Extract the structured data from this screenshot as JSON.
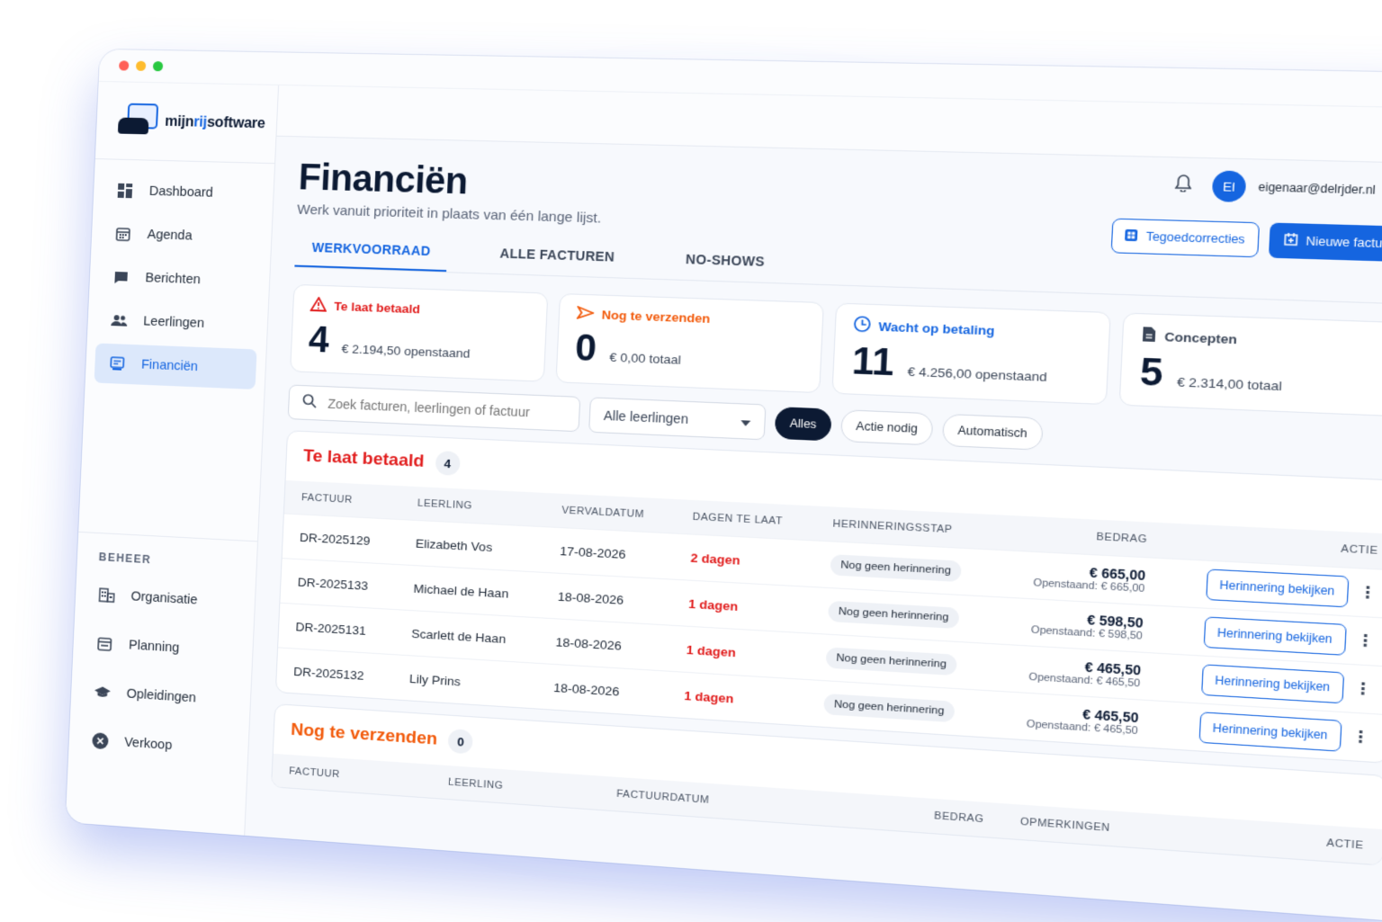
{
  "brand": {
    "prefix": "mijn",
    "accent": "rij",
    "suffix": "software"
  },
  "sidebar": {
    "items": [
      {
        "label": "Dashboard",
        "icon": "grid-icon"
      },
      {
        "label": "Agenda",
        "icon": "calendar-icon"
      },
      {
        "label": "Berichten",
        "icon": "chat-icon"
      },
      {
        "label": "Leerlingen",
        "icon": "users-icon"
      },
      {
        "label": "Financiën",
        "icon": "invoice-icon",
        "active": true
      }
    ],
    "section_label": "BEHEER",
    "section_items": [
      {
        "label": "Organisatie",
        "icon": "building-icon"
      },
      {
        "label": "Planning",
        "icon": "calendar-check-icon"
      },
      {
        "label": "Opleidingen",
        "icon": "graduation-cap-icon"
      },
      {
        "label": "Verkoop",
        "icon": "close-circle-icon"
      }
    ]
  },
  "user": {
    "initials": "EI",
    "email": "eigenaar@delrjder.nl"
  },
  "page": {
    "title": "Financiën",
    "subtitle": "Werk vanuit prioriteit in plaats van één lange lijst.",
    "btn_credit": "Tegoedcorrecties",
    "btn_new": "Nieuwe factuur"
  },
  "tabs": [
    {
      "label": "WERKVOORRAAD",
      "active": true
    },
    {
      "label": "ALLE FACTUREN"
    },
    {
      "label": "NO-SHOWS"
    }
  ],
  "stats": [
    {
      "title": "Te laat betaald",
      "number": "4",
      "sub": "€ 2.194,50 openstaand",
      "color": "#e11d1d",
      "icon": "warning-icon"
    },
    {
      "title": "Nog te verzenden",
      "number": "0",
      "sub": "€ 0,00 totaal",
      "color": "#f25a0b",
      "icon": "send-icon"
    },
    {
      "title": "Wacht op betaling",
      "number": "11",
      "sub": "€ 4.256,00 openstaand",
      "color": "#1565e0",
      "icon": "clock-icon"
    },
    {
      "title": "Concepten",
      "number": "5",
      "sub": "€ 2.314,00 totaal",
      "color": "#3b4658",
      "icon": "document-icon"
    }
  ],
  "filters": {
    "search_placeholder": "Zoek facturen, leerlingen of factuur",
    "select_value": "Alle leerlingen",
    "chips": [
      {
        "label": "Alles",
        "active": true
      },
      {
        "label": "Actie nodig"
      },
      {
        "label": "Automatisch"
      }
    ]
  },
  "late_panel": {
    "title": "Te laat betaald",
    "count": "4",
    "columns": [
      "FACTUUR",
      "LEERLING",
      "VERVALDATUM",
      "DAGEN TE LAAT",
      "HERINNERINGSSTAP",
      "BEDRAG",
      "ACTIE"
    ],
    "rows": [
      {
        "invoice": "DR-2025129",
        "student": "Elizabeth Vos",
        "due": "17-08-2026",
        "days": "2 dagen",
        "step": "Nog geen herinnering",
        "amount": "€ 665,00",
        "open": "Openstaand: € 665,00",
        "action": "Herinnering bekijken"
      },
      {
        "invoice": "DR-2025133",
        "student": "Michael de Haan",
        "due": "18-08-2026",
        "days": "1 dagen",
        "step": "Nog geen herinnering",
        "amount": "€ 598,50",
        "open": "Openstaand: € 598,50",
        "action": "Herinnering bekijken"
      },
      {
        "invoice": "DR-2025131",
        "student": "Scarlett de Haan",
        "due": "18-08-2026",
        "days": "1 dagen",
        "step": "Nog geen herinnering",
        "amount": "€ 465,50",
        "open": "Openstaand: € 465,50",
        "action": "Herinnering bekijken"
      },
      {
        "invoice": "DR-2025132",
        "student": "Lily Prins",
        "due": "18-08-2026",
        "days": "1 dagen",
        "step": "Nog geen herinnering",
        "amount": "€ 465,50",
        "open": "Openstaand: € 465,50",
        "action": "Herinnering bekijken"
      }
    ]
  },
  "send_panel": {
    "title": "Nog te verzenden",
    "count": "0",
    "columns": [
      "FACTUUR",
      "LEERLING",
      "FACTUURDATUM",
      "BEDRAG",
      "OPMERKINGEN",
      "ACTIE"
    ]
  },
  "colors": {
    "accent": "#1565e0",
    "danger": "#e11d1d",
    "warning": "#f25a0b",
    "navy": "#0c1a33"
  }
}
